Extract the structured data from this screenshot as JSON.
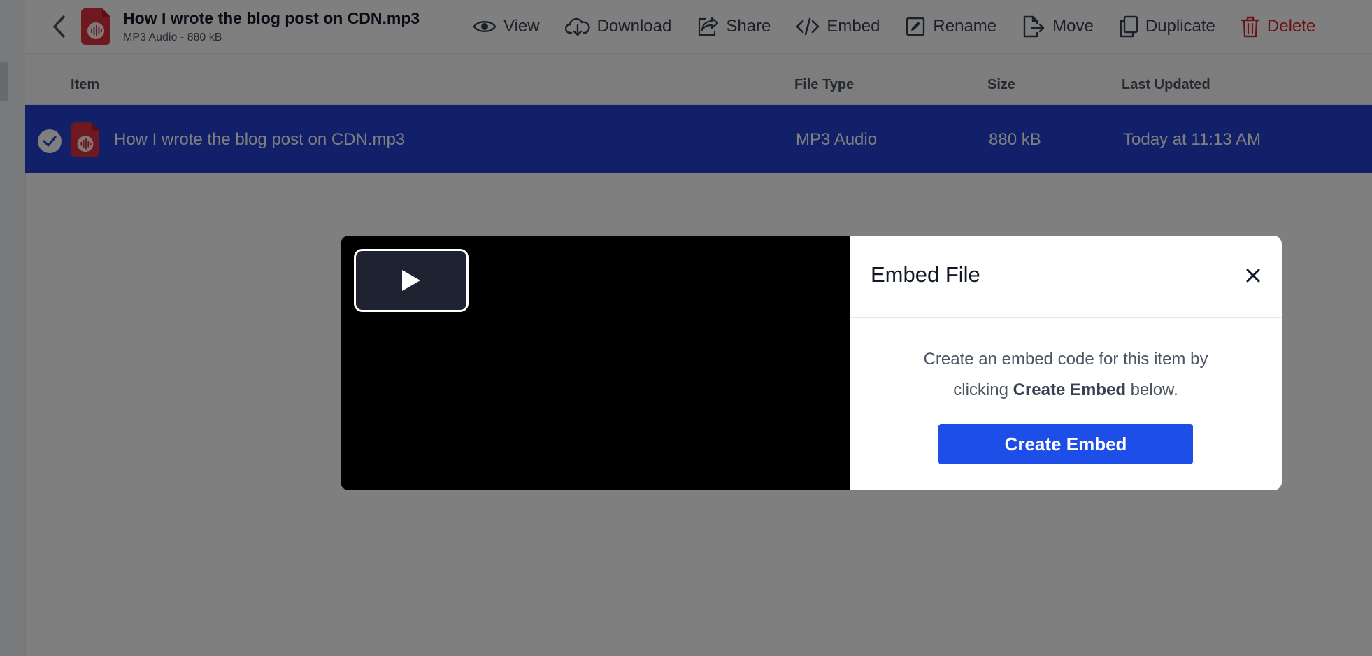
{
  "file": {
    "title": "How I wrote the blog post on CDN.mp3",
    "subtitle": "MP3 Audio - 880 kB",
    "icon": "audio-file-icon"
  },
  "toolbar": {
    "actions": [
      {
        "label": "View",
        "icon": "eye-icon"
      },
      {
        "label": "Download",
        "icon": "cloud-download-icon"
      },
      {
        "label": "Share",
        "icon": "share-icon"
      },
      {
        "label": "Embed",
        "icon": "code-icon"
      },
      {
        "label": "Rename",
        "icon": "edit-icon"
      },
      {
        "label": "Move",
        "icon": "move-file-icon"
      },
      {
        "label": "Duplicate",
        "icon": "duplicate-icon"
      },
      {
        "label": "Delete",
        "icon": "trash-icon"
      }
    ]
  },
  "table": {
    "headers": [
      "Item",
      "File Type",
      "Size",
      "Last Updated"
    ],
    "rows": [
      {
        "name": "How I wrote the blog post on CDN.mp3",
        "type": "MP3 Audio",
        "size": "880 kB",
        "updated": "Today at 11:13 AM",
        "selected": true
      }
    ]
  },
  "modal": {
    "title": "Embed File",
    "description_pre": "Create an embed code for this item by clicking ",
    "description_bold": "Create Embed",
    "description_post": " below.",
    "button_label": "Create Embed"
  },
  "colors": {
    "selected_row": "#2541d4",
    "primary_button": "#1d4ee8",
    "delete": "#dc2626",
    "file_icon": "#e03040"
  }
}
